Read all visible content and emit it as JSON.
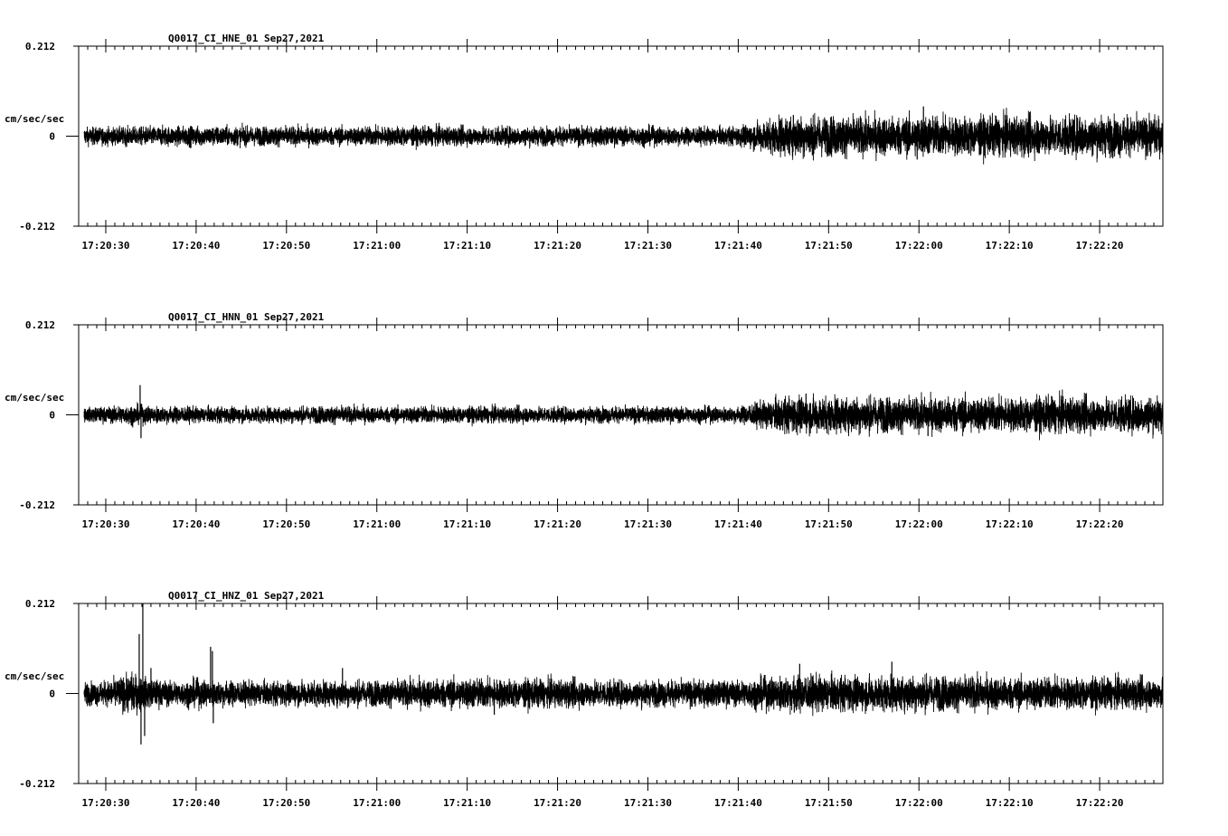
{
  "chart_data": [
    {
      "type": "line",
      "title": "Q0017_CI_HNE_01  Sep27,2021",
      "ylabel": "cm/sec/sec",
      "ylim": [
        -0.212,
        0.212
      ],
      "ytick_labels": [
        "0.212",
        "0",
        "-0.212"
      ],
      "x_tick_labels": [
        "17:20:30",
        "17:20:40",
        "17:20:50",
        "17:21:00",
        "17:21:10",
        "17:21:20",
        "17:21:30",
        "17:21:40",
        "17:21:50",
        "17:22:00",
        "17:22:10",
        "17:22:20"
      ],
      "x_range_seconds_after_17_20_00": [
        27.0,
        87.0
      ],
      "trace_start_seconds_after_17_20_00": 27.6,
      "series": [
        {
          "envelope_seconds": [
            27.6,
            30,
            35,
            40,
            45,
            50,
            55,
            60,
            65,
            70,
            75,
            80,
            85,
            90,
            95,
            100,
            103,
            105,
            110,
            115,
            120,
            125,
            130,
            135,
            140,
            145,
            147
          ],
          "envelope_amplitude": [
            0.022,
            0.022,
            0.024,
            0.025,
            0.024,
            0.024,
            0.023,
            0.024,
            0.024,
            0.023,
            0.024,
            0.023,
            0.024,
            0.024,
            0.022,
            0.024,
            0.04,
            0.05,
            0.05,
            0.048,
            0.05,
            0.048,
            0.05,
            0.048,
            0.05,
            0.048,
            0.05
          ],
          "spikes": [
            {
              "t": 106.1,
              "v": 0.05
            },
            {
              "t": 120.5,
              "v": 0.07
            },
            {
              "t": 137.8,
              "v": 0.045
            },
            {
              "t": 108.2,
              "v": -0.045
            },
            {
              "t": 119.8,
              "v": -0.055
            }
          ]
        }
      ]
    },
    {
      "type": "line",
      "title": "Q0017_CI_HNN_01  Sep27,2021",
      "ylabel": "cm/sec/sec",
      "ylim": [
        -0.212,
        0.212
      ],
      "ytick_labels": [
        "0.212",
        "0",
        "-0.212"
      ],
      "x_tick_labels": [
        "17:20:30",
        "17:20:40",
        "17:20:50",
        "17:21:00",
        "17:21:10",
        "17:21:20",
        "17:21:30",
        "17:21:40",
        "17:21:50",
        "17:22:00",
        "17:22:10",
        "17:22:20"
      ],
      "x_range_seconds_after_17_20_00": [
        27.0,
        87.0
      ],
      "trace_start_seconds_after_17_20_00": 27.6,
      "series": [
        {
          "envelope_seconds": [
            27.6,
            30,
            33,
            35,
            40,
            45,
            50,
            55,
            60,
            65,
            70,
            75,
            80,
            85,
            90,
            95,
            100,
            103,
            105,
            110,
            115,
            120,
            125,
            130,
            135,
            140,
            145,
            147
          ],
          "envelope_amplitude": [
            0.018,
            0.02,
            0.025,
            0.022,
            0.02,
            0.02,
            0.02,
            0.022,
            0.02,
            0.021,
            0.02,
            0.02,
            0.02,
            0.02,
            0.02,
            0.02,
            0.02,
            0.035,
            0.045,
            0.045,
            0.045,
            0.042,
            0.045,
            0.042,
            0.045,
            0.042,
            0.045,
            0.045
          ],
          "spikes": [
            {
              "t": 33.8,
              "v": 0.07
            },
            {
              "t": 33.9,
              "v": -0.055
            },
            {
              "t": 107.5,
              "v": 0.05
            },
            {
              "t": 121.0,
              "v": -0.05
            },
            {
              "t": 145.5,
              "v": 0.04
            }
          ]
        }
      ]
    },
    {
      "type": "line",
      "title": "Q0017_CI_HNZ_01  Sep27,2021",
      "ylabel": "cm/sec/sec",
      "ylim": [
        -0.212,
        0.212
      ],
      "ytick_labels": [
        "0.212",
        "0",
        "-0.212"
      ],
      "x_tick_labels": [
        "17:20:30",
        "17:20:40",
        "17:20:50",
        "17:21:00",
        "17:21:10",
        "17:21:20",
        "17:21:30",
        "17:21:40",
        "17:21:50",
        "17:22:00",
        "17:22:10",
        "17:22:20"
      ],
      "x_range_seconds_after_17_20_00": [
        27.0,
        87.0
      ],
      "trace_start_seconds_after_17_20_00": 27.6,
      "series": [
        {
          "envelope_seconds": [
            27.6,
            30,
            33,
            35,
            38,
            40,
            45,
            50,
            55,
            60,
            65,
            70,
            75,
            80,
            85,
            90,
            95,
            100,
            103,
            105,
            110,
            115,
            120,
            125,
            130,
            135,
            140,
            145,
            147
          ],
          "envelope_amplitude": [
            0.028,
            0.03,
            0.05,
            0.035,
            0.03,
            0.035,
            0.03,
            0.03,
            0.032,
            0.032,
            0.035,
            0.038,
            0.035,
            0.035,
            0.033,
            0.032,
            0.032,
            0.032,
            0.04,
            0.045,
            0.045,
            0.042,
            0.045,
            0.042,
            0.04,
            0.04,
            0.038,
            0.038,
            0.038
          ],
          "spikes": [
            {
              "t": 33.7,
              "v": 0.14
            },
            {
              "t": 33.9,
              "v": -0.12
            },
            {
              "t": 34.1,
              "v": 0.212
            },
            {
              "t": 34.3,
              "v": -0.1
            },
            {
              "t": 35.0,
              "v": 0.06
            },
            {
              "t": 41.6,
              "v": 0.11
            },
            {
              "t": 41.9,
              "v": -0.07
            },
            {
              "t": 41.8,
              "v": 0.1
            },
            {
              "t": 56.2,
              "v": 0.06
            },
            {
              "t": 73.0,
              "v": -0.05
            },
            {
              "t": 106.8,
              "v": 0.07
            },
            {
              "t": 117.0,
              "v": 0.075
            },
            {
              "t": 106.2,
              "v": -0.045
            }
          ]
        }
      ]
    }
  ]
}
